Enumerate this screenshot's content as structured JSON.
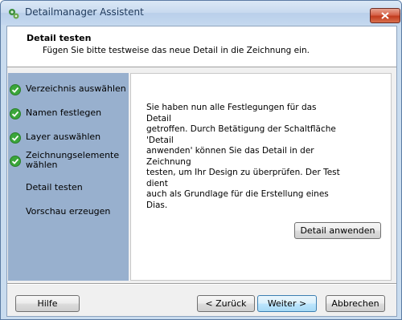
{
  "window": {
    "title": "Detailmanager Assistent"
  },
  "header": {
    "title": "Detail testen",
    "subtitle": "Fügen Sie bitte testweise das neue Detail in die Zeichnung ein."
  },
  "steps": [
    {
      "label": "Verzeichnis auswählen",
      "done": true
    },
    {
      "label": "Namen festlegen",
      "done": true
    },
    {
      "label": "Layer auswählen",
      "done": true
    },
    {
      "label_line1": "Zeichnungselemente",
      "label_line2": "wählen",
      "done": true
    },
    {
      "label": "Detail testen",
      "done": false
    },
    {
      "label": "Vorschau erzeugen",
      "done": false
    }
  ],
  "content": {
    "description_lines": [
      "Sie haben nun alle Festlegungen für das Detail",
      "getroffen. Durch Betätigung der Schaltfläche 'Detail",
      "anwenden' können Sie das Detail in der Zeichnung",
      "testen, um Ihr Design zu überprüfen. Der Test dient",
      "auch als Grundlage für die Erstellung eines Dias."
    ],
    "apply_button": "Detail anwenden"
  },
  "footer": {
    "help": "Hilfe",
    "back": "< Zurück",
    "next": "Weiter >",
    "cancel": "Abbrechen"
  },
  "colors": {
    "step_panel": "#98b0ce",
    "check": "#3aa63a",
    "close": "#c23b1e"
  }
}
